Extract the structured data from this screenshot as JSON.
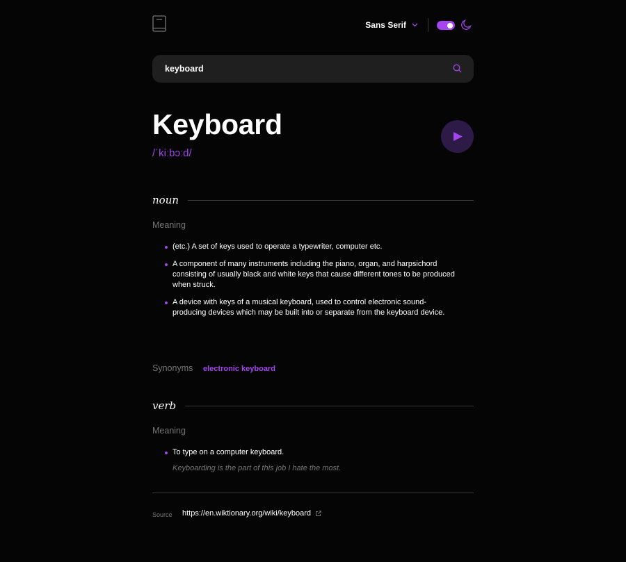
{
  "header": {
    "font_selected": "Sans Serif",
    "theme_dark": true
  },
  "search": {
    "value": "keyboard"
  },
  "entry": {
    "word": "Keyboard",
    "phonetic": "/ˈkiːbɔːd/"
  },
  "noun": {
    "part_of_speech": "noun",
    "meaning_label": "Meaning",
    "definitions": [
      "(etc.) A set of keys used to operate a typewriter, computer etc.",
      "A component of many instruments including the piano, organ, and harpsichord consisting of usually black and white keys that cause different tones to be produced when struck.",
      "A device with keys of a musical keyboard, used to control electronic sound-producing devices which may be built into or separate from the keyboard device."
    ],
    "synonyms_label": "Synonyms",
    "synonyms": [
      "electronic keyboard"
    ]
  },
  "verb": {
    "part_of_speech": "verb",
    "meaning_label": "Meaning",
    "definitions": [
      "To type on a computer keyboard."
    ],
    "example": "Keyboarding is the part of this job I hate the most."
  },
  "source": {
    "label": "Source",
    "url": "https://en.wiktionary.org/wiki/keyboard"
  },
  "colors": {
    "accent": "#a445ed",
    "background": "#050505",
    "muted": "#757575",
    "input_bg": "#1f1f1f"
  },
  "icons": {
    "logo": "book-icon",
    "dropdown": "chevron-down-icon",
    "theme": "moon-icon",
    "search": "search-icon",
    "play": "play-icon",
    "external": "external-link-icon"
  }
}
